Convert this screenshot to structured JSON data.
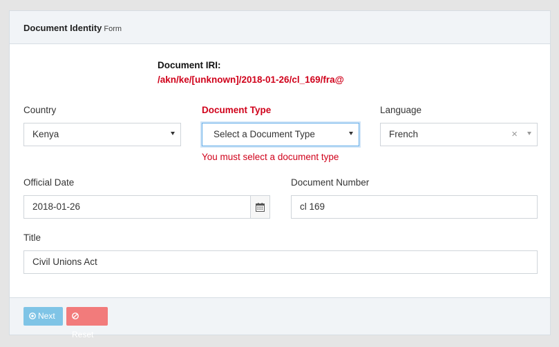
{
  "header": {
    "title": "Document Identity",
    "subtitle": "Form"
  },
  "iri": {
    "label": "Document IRI:",
    "value": "/akn/ke/[unknown]/2018-01-26/cl_169/fra@"
  },
  "fields": {
    "country": {
      "label": "Country",
      "value": "Kenya"
    },
    "document_type": {
      "label": "Document Type",
      "placeholder": "Select a Document Type",
      "error": "You must select a document type"
    },
    "language": {
      "label": "Language",
      "value": "French",
      "clear": "×"
    },
    "official_date": {
      "label": "Official Date",
      "value": "2018-01-26"
    },
    "document_number": {
      "label": "Document Number",
      "value": "cl 169"
    },
    "title": {
      "label": "Title",
      "value": "Civil Unions Act"
    }
  },
  "footer": {
    "next_label": "Next",
    "reset_label": "Reset"
  },
  "colors": {
    "error": "#d0021b",
    "next_button": "#7fc4e6",
    "reset_button": "#f27b7b",
    "focus_border": "#66afe9"
  }
}
